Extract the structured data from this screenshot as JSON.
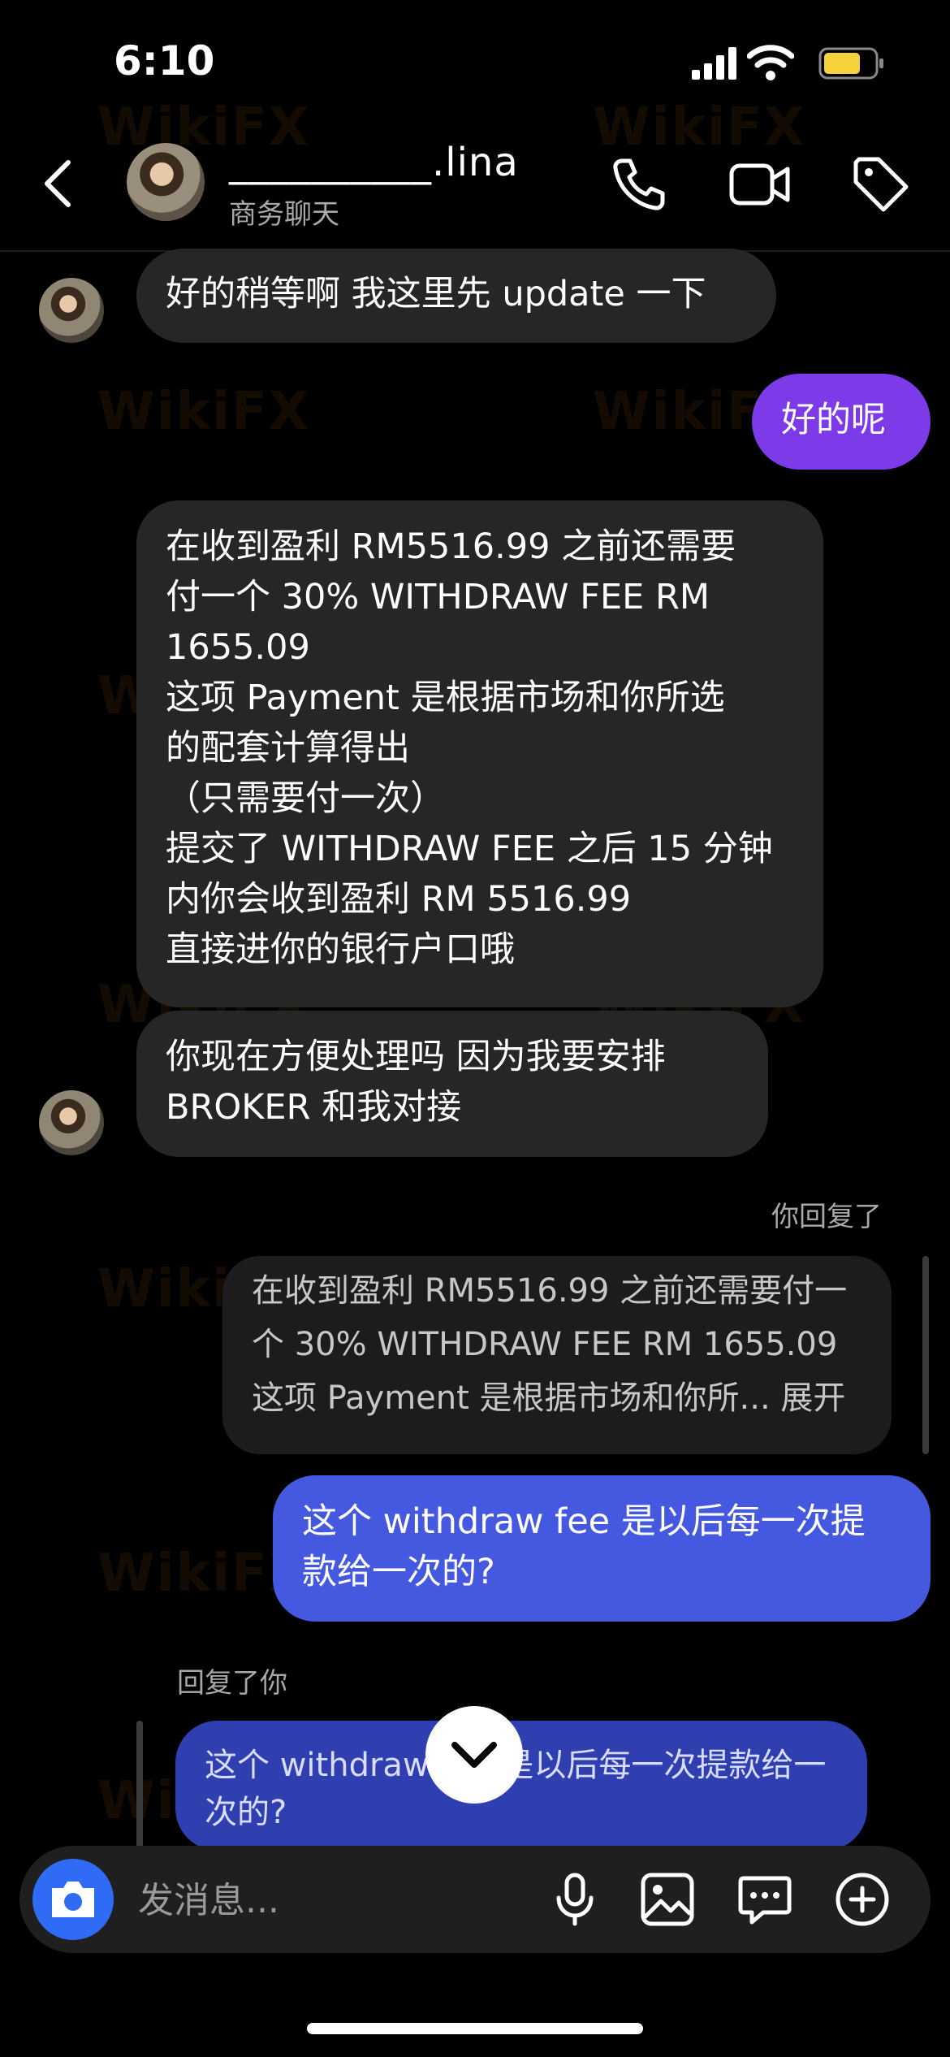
{
  "status": {
    "time": "6:10"
  },
  "header": {
    "name": "__________.lina",
    "subtitle": "商务聊天"
  },
  "messages": {
    "m1": "好的稍等啊 我这里先 update 一下",
    "m2": "好的呢",
    "m3": "在收到盈利 RM5516.99 之前还需要\n付一个 30% WITHDRAW FEE RM\n1655.09\n这项 Payment 是根据市场和你所选\n的配套计算得出\n（只需要付一次）\n提交了 WITHDRAW FEE 之后 15 分钟\n内你会收到盈利 RM 5516.99\n直接进你的银行户口哦",
    "m4": "你现在方便处理吗 因为我要安排\nBROKER 和我对接",
    "reply_label": "你回复了",
    "quote": "在收到盈利 RM5516.99 之前还需要付一\n个 30% WITHDRAW FEE RM 1655.09\n这项 Payment 是根据市场和你所... 展开",
    "m5": "这个 withdraw fee 是以后每一次提\n款给一次的?",
    "reply_label2": "回复了你",
    "quote2": "这个 withdraw fee 是以后每一次提款给一\n次的?"
  },
  "watermark": "WikiFX",
  "composer": {
    "placeholder": "发消息..."
  },
  "colors": {
    "purple": "#7c3ae8",
    "blue": "#4559e0",
    "camera": "#2f6bf5",
    "incoming": "#262626"
  }
}
